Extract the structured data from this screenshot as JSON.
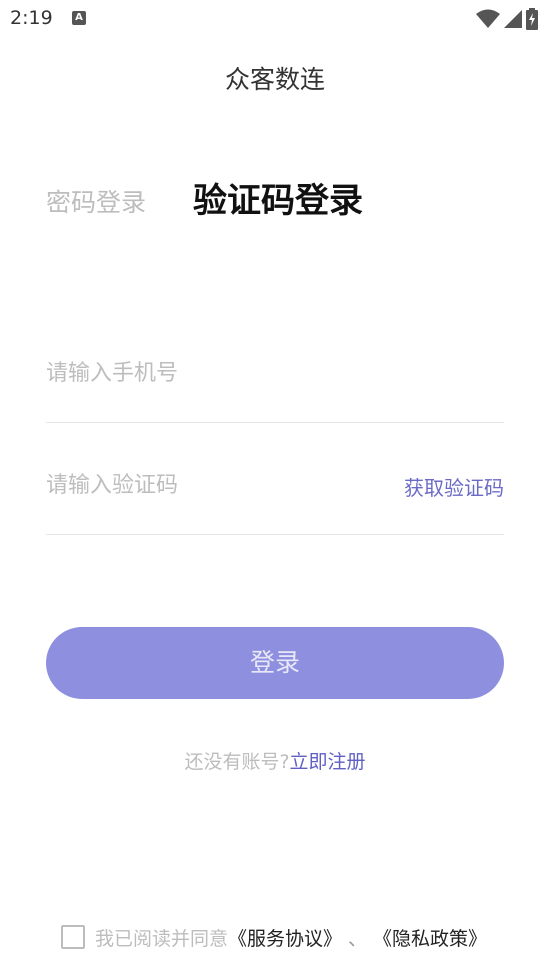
{
  "status_bar": {
    "time": "2:19",
    "notification_icon_letter": "A",
    "icons": [
      "wifi-icon",
      "signal-icon",
      "battery-charging-icon"
    ]
  },
  "app": {
    "title": "众客数连"
  },
  "tabs": [
    {
      "label": "密码登录",
      "active": false
    },
    {
      "label": "验证码登录",
      "active": true
    }
  ],
  "form": {
    "phone": {
      "value": "",
      "placeholder": "请输入手机号"
    },
    "code": {
      "value": "",
      "placeholder": "请输入验证码"
    },
    "get_code_label": "获取验证码",
    "login_label": "登录"
  },
  "register": {
    "hint": "还没有账号?",
    "link": "立即注册"
  },
  "agreement": {
    "checked": false,
    "text": "我已阅读并同意",
    "service_link": "《服务协议》",
    "separator": "、",
    "privacy_link": "《隐私政策》"
  },
  "colors": {
    "accent": "#6b6bc6",
    "button": "#8e8fdf",
    "muted": "#bdbdbd"
  }
}
